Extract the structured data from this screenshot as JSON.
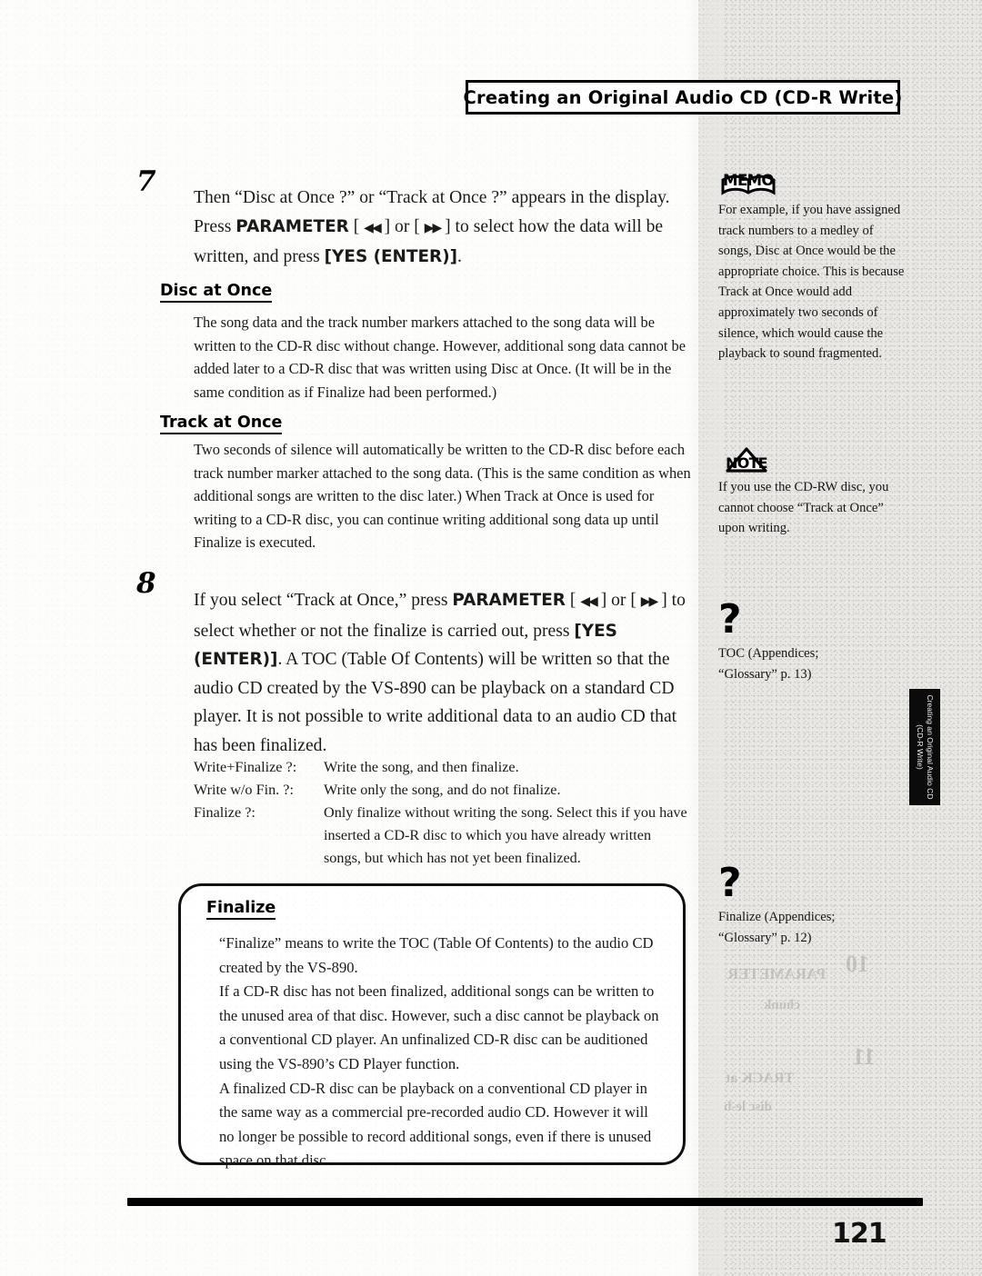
{
  "header": {
    "title": "Creating an Original Audio CD (CD-R Write)"
  },
  "page": {
    "folio": "121",
    "thumb_tab": "Creating an Original Audio CD (CD-R Write)"
  },
  "steps": [
    {
      "number": "7",
      "text_parts": {
        "p1": "Then “Disc at Once ?” or “Track at Once ?” appears in the display. Press ",
        "bold1": "PARAMETER",
        "bracket_open": " [ ",
        "arrow_rew": "◀◀",
        "mid1": " ] or [ ",
        "arrow_ff": "▶▶",
        "mid2": " ] to select how the data will be written, and press ",
        "bold2": "[YES (ENTER)]",
        "end": "."
      }
    },
    {
      "number": "8",
      "text_parts": {
        "p1": "If you select “Track at Once,” press ",
        "bold1": "PARAMETER",
        "bracket_open": " [ ",
        "arrow_rew": "◀◀",
        "mid1": " ] or [ ",
        "arrow_ff": "▶▶",
        "mid2": " ] to select whether or not the finalize is carried out, press ",
        "bold2": "[YES (ENTER)]",
        "end": ". A TOC (Table Of Contents) will be written so that the audio CD created by the VS-890 can be playback on a standard CD player. It is not possible to write additional data to an audio CD that has been finalized."
      }
    }
  ],
  "sections": [
    {
      "heading": "Disc at Once",
      "body": "The song data and the track number markers attached to the song data will be written to the CD-R disc without change. However, additional song data cannot be added later to a CD-R disc that was written using Disc at Once. (It will be in the same condition as if Finalize had been performed.)"
    },
    {
      "heading": "Track at Once",
      "body": "Two seconds of silence will automatically be written to the CD-R disc before each track number marker attached to the song data. (This is the same condition as when additional songs are written to the disc later.) When Track at Once is used for writing to a CD-R disc, you can continue writing additional song data up until Finalize is executed."
    }
  ],
  "definitions": [
    {
      "term": "Write+Finalize ?:",
      "desc": "Write the song, and then finalize."
    },
    {
      "term": "Write w/o Fin. ?:",
      "desc": "Write only the song, and do not finalize."
    },
    {
      "term": "Finalize ?:",
      "desc": "Only finalize without writing the song. Select this if you have inserted a CD-R disc to which you have already written songs, but which has not yet been finalized."
    }
  ],
  "finalize_box": {
    "heading": "Finalize",
    "paragraphs": [
      "“Finalize” means to write the TOC (Table Of Contents) to the audio CD created by the VS-890.",
      "If a CD-R disc has not been finalized, additional songs can be written to the unused area of that disc. However, such a disc cannot be playback on a conventional CD player. An unfinalized CD-R disc can be auditioned using the VS-890’s CD Player function.",
      "A finalized CD-R disc can be playback on a conventional CD player in the same way as a commercial pre-recorded audio CD. However it will no longer be possible to record additional songs, even if there is unused space on that disc."
    ]
  },
  "sidebar": {
    "memo": {
      "icon_label": "MEMO",
      "text": "For example, if you have assigned track numbers to a medley of songs, Disc at Once would be the appropriate choice. This is because Track at Once would add approximately two seconds of silence, which would cause the playback to sound fragmented."
    },
    "note": {
      "icon_label": "NOTE",
      "text": "If you use the CD-RW disc, you cannot choose “Track at Once” upon writing."
    },
    "refs": [
      {
        "icon": "question-mark",
        "line1": "TOC (Appendices;",
        "line2": "“Glossary” p. 13)"
      },
      {
        "icon": "question-mark",
        "line1": "Finalize (Appendices;",
        "line2": "“Glossary” p. 12)"
      }
    ]
  },
  "colors": {
    "ink": "#111111",
    "paper": "#fdfdfc",
    "sidebar_bg": "#e9e8e5",
    "tab_bg": "#0b0b0b"
  }
}
